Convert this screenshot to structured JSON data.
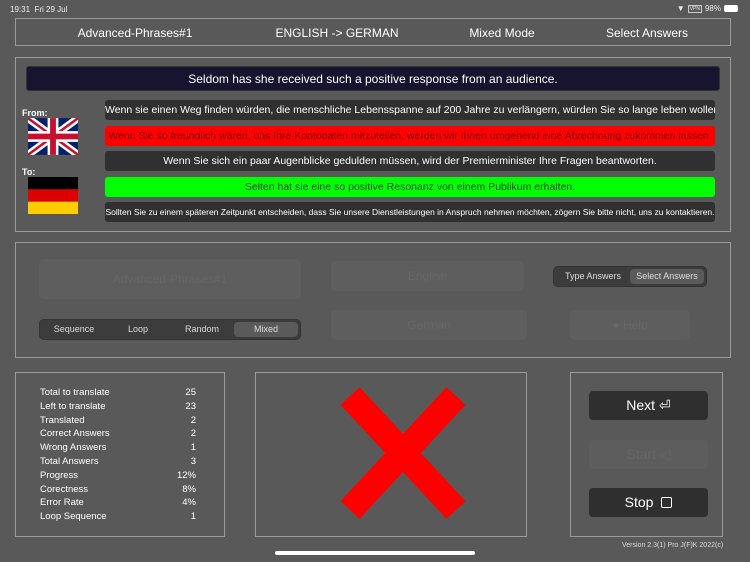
{
  "status_bar": {
    "time": "19:31",
    "date": "Fri 29 Jul",
    "battery": "98%",
    "vpn": "VPN"
  },
  "header": {
    "deck": "Advanced-Phrases#1",
    "direction": "ENGLISH -> GERMAN",
    "mode": "Mixed Mode",
    "answer_type": "Select Answers"
  },
  "quiz": {
    "prompt": "Seldom has she received such a positive response from an audience.",
    "from_label": "From:",
    "to_label": "To:",
    "answers": [
      {
        "text": "Wenn sie einen Weg finden würden, die menschliche Lebensspanne auf 200 Jahre zu verlängern, würden Sie so lange leben wollen?",
        "state": "neutral"
      },
      {
        "text": "Wenn Sie so freundlich wären, uns Ihre Kontodaten mitzuteilen, werden wir Ihnen umgehend eine Abrechnung zukommen lassen.",
        "state": "wrong"
      },
      {
        "text": "Wenn Sie sich ein paar Augenblicke gedulden müssen, wird der Premierminister Ihre Fragen beantworten.",
        "state": "neutral"
      },
      {
        "text": "Selten hat sie eine so positive Resonanz von einem Publikum erhalten.",
        "state": "correct"
      },
      {
        "text": "Sollten Sie zu einem späteren Zeitpunkt entscheiden, dass Sie unsere Dienstleistungen in Anspruch nehmen möchten, zögern Sie bitte nicht, uns zu kontaktieren.",
        "state": "neutral"
      }
    ]
  },
  "settings": {
    "deck": "Advanced-Phrases#1",
    "source": "English",
    "target": "German",
    "help": "Help",
    "answer_modes": [
      "Type Answers",
      "Select Answers"
    ],
    "order_modes": [
      "Sequence",
      "Loop",
      "Random",
      "Mixed"
    ]
  },
  "stats": [
    {
      "label": "Total to translate",
      "value": "25"
    },
    {
      "label": "Left to translate",
      "value": "23"
    },
    {
      "label": "Translated",
      "value": "2"
    },
    {
      "label": "Correct Answers",
      "value": "2"
    },
    {
      "label": "Wrong Answers",
      "value": "1"
    },
    {
      "label": "Total Answers",
      "value": "3"
    },
    {
      "label": "Progress",
      "value": "12%"
    },
    {
      "label": "Corectness",
      "value": "8%"
    },
    {
      "label": "Error Rate",
      "value": "4%"
    },
    {
      "label": "Loop Sequence",
      "value": "1"
    }
  ],
  "controls": {
    "next": "Next",
    "start": "Start",
    "stop": "Stop"
  },
  "version": "Version 2.3(1) Pro J(F)K 2022(c)",
  "colors": {
    "wrong": "#ff0000",
    "correct": "#00ff00",
    "prompt_bg": "#16142e"
  }
}
